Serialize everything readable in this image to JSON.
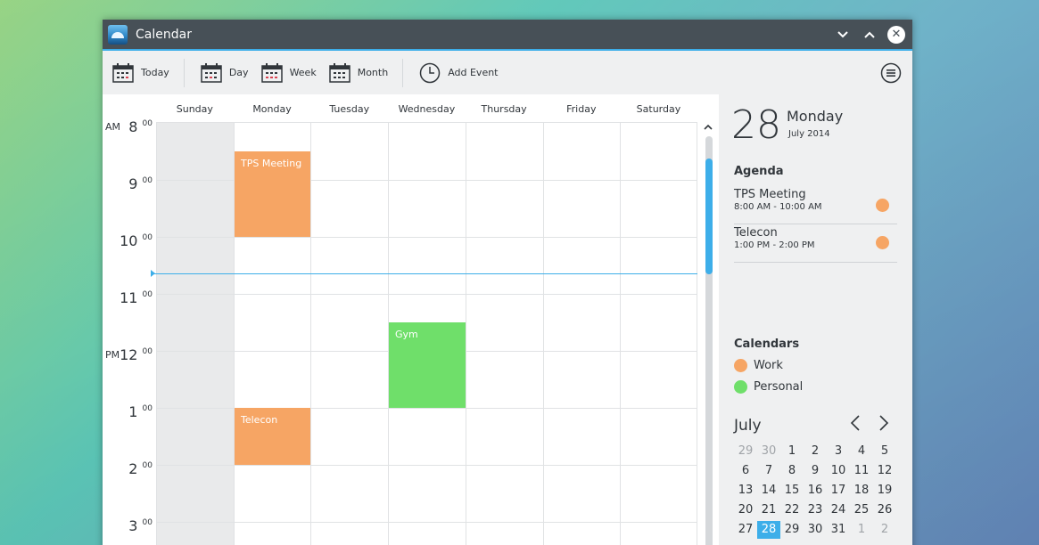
{
  "window": {
    "title": "Calendar"
  },
  "toolbar": {
    "today": "Today",
    "day": "Day",
    "week": "Week",
    "month": "Month",
    "add_event": "Add Event"
  },
  "week_view": {
    "days": [
      "Sunday",
      "Monday",
      "Tuesday",
      "Wednesday",
      "Thursday",
      "Friday",
      "Saturday"
    ],
    "hours": [
      {
        "ampm": "AM",
        "h": "8",
        "m": "00"
      },
      {
        "ampm": "",
        "h": "9",
        "m": "00"
      },
      {
        "ampm": "",
        "h": "10",
        "m": "00"
      },
      {
        "ampm": "",
        "h": "11",
        "m": "00"
      },
      {
        "ampm": "PM",
        "h": "12",
        "m": "00"
      },
      {
        "ampm": "",
        "h": "1",
        "m": "00"
      },
      {
        "ampm": "",
        "h": "2",
        "m": "00"
      },
      {
        "ampm": "",
        "h": "3",
        "m": "00"
      }
    ],
    "events": [
      {
        "title": "TPS Meeting",
        "calendar": "Work"
      },
      {
        "title": "Gym",
        "calendar": "Personal"
      },
      {
        "title": "Telecon",
        "calendar": "Work"
      }
    ]
  },
  "sidebar": {
    "day_number": "28",
    "weekday": "Monday",
    "month_year": "July 2014",
    "agenda_title": "Agenda",
    "agenda": [
      {
        "title": "TPS Meeting",
        "time": "8:00 AM - 10:00 AM"
      },
      {
        "title": "Telecon",
        "time": "1:00 PM - 2:00 PM"
      }
    ],
    "calendars_title": "Calendars",
    "calendars": [
      {
        "name": "Work",
        "color": "#f6a564"
      },
      {
        "name": "Personal",
        "color": "#6fdf6a"
      }
    ],
    "mini_calendar": {
      "month": "July",
      "weeks": [
        [
          "29",
          "30",
          "1",
          "2",
          "3",
          "4",
          "5"
        ],
        [
          "6",
          "7",
          "8",
          "9",
          "10",
          "11",
          "12"
        ],
        [
          "13",
          "14",
          "15",
          "16",
          "17",
          "18",
          "19"
        ],
        [
          "20",
          "21",
          "22",
          "23",
          "24",
          "25",
          "26"
        ],
        [
          "27",
          "28",
          "29",
          "30",
          "31",
          "1",
          "2"
        ]
      ],
      "selected": "28"
    }
  },
  "colors": {
    "accent": "#3daee9",
    "work": "#f6a564",
    "personal": "#6fdf6a",
    "titlebar": "#475057"
  }
}
